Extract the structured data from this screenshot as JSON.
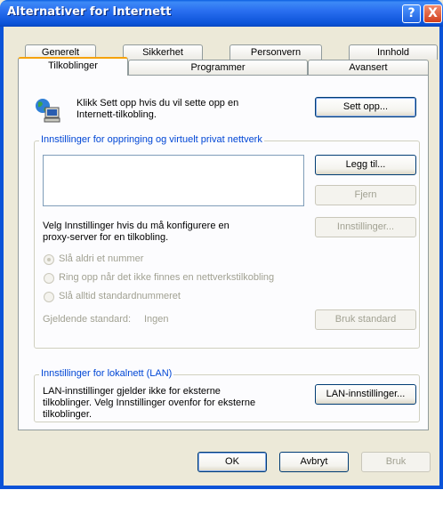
{
  "window": {
    "title": "Alternativer for Internett"
  },
  "titlebar": {
    "help_glyph": "?",
    "close_glyph": "X"
  },
  "tabs": {
    "row1": [
      "Generelt",
      "Sikkerhet",
      "Personvern",
      "Innhold"
    ],
    "row2": [
      "Tilkoblinger",
      "Programmer",
      "Avansert"
    ],
    "active": "Tilkoblinger"
  },
  "setup": {
    "text_line1": "Klikk Sett opp hvis du vil sette opp en",
    "text_line2": "Internett-tilkobling.",
    "button": "Sett opp...",
    "icon": "network-computer-icon"
  },
  "dialup_group": {
    "title": "Innstillinger for oppringing og virtuelt privat nettverk",
    "add_button": "Legg til...",
    "remove_button": "Fjern",
    "proxy_text_line1": "Velg Innstillinger hvis du må konfigurere en",
    "proxy_text_line2": "proxy-server for en tilkobling.",
    "settings_button": "Innstillinger...",
    "radio_options": [
      "Slå aldri et nummer",
      "Ring opp når det ikke finnes en nettverkstilkobling",
      "Slå alltid standardnummeret"
    ],
    "selected_radio": 0,
    "default_label": "Gjeldende standard:",
    "default_value": "Ingen",
    "set_default_button": "Bruk standard"
  },
  "lan_group": {
    "title": "Innstillinger for lokalnett (LAN)",
    "text_line1": "LAN-innstillinger gjelder ikke for eksterne",
    "text_line2": "tilkoblinger. Velg Innstillinger ovenfor for eksterne",
    "text_line3": "tilkoblinger.",
    "button": "LAN-innstillinger..."
  },
  "footer": {
    "ok": "OK",
    "cancel": "Avbryt",
    "apply": "Bruk"
  },
  "colors": {
    "accent": "#0046d5",
    "title_bar": "#0b53d8",
    "tab_highlight": "#f5a20a"
  }
}
